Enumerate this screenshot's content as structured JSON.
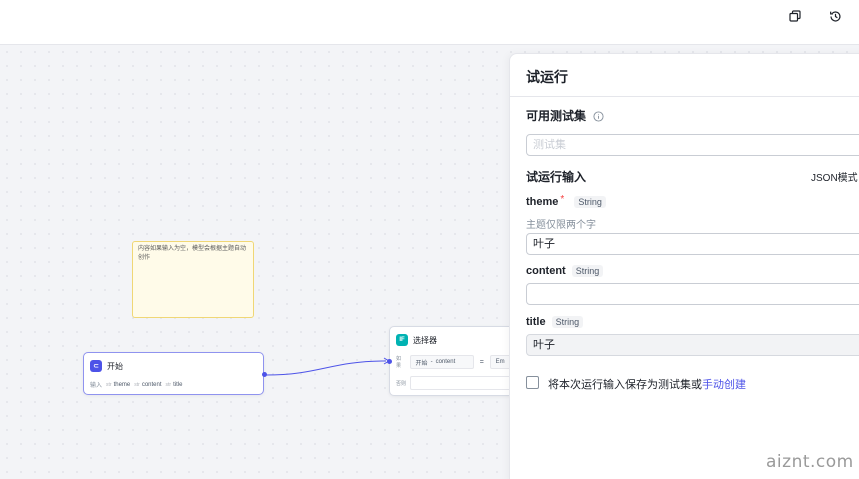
{
  "canvas": {
    "note": {
      "text": "内容如果输入为空，模型会根据主题自动创作"
    },
    "start_node": {
      "icon_text": "⊂",
      "title": "开始",
      "input_label": "输入",
      "params": [
        {
          "type": "str",
          "name": "theme"
        },
        {
          "type": "str",
          "name": "content"
        },
        {
          "type": "str",
          "name": "title"
        }
      ]
    },
    "if_node": {
      "icon_text": "IF",
      "title": "选择器",
      "if_label": "如果",
      "condition_source": "开始",
      "condition_sep": "-",
      "condition_field": "content",
      "condition_op": "=",
      "condition_value": "Em",
      "else_label": "否则"
    }
  },
  "panel": {
    "title": "试运行",
    "testset_section": "可用测试集",
    "testset_placeholder": "测试集",
    "input_section": "试运行输入",
    "json_mode": "JSON模式",
    "fields": [
      {
        "name": "theme",
        "required_mark": "*",
        "type": "String",
        "hint": "主题仅限两个字",
        "value": "叶子"
      },
      {
        "name": "content",
        "type": "String",
        "value": ""
      },
      {
        "name": "title",
        "type": "String",
        "value": "叶子"
      }
    ],
    "save_text": "将本次运行输入保存为测试集或",
    "save_link": "手动创建"
  },
  "watermark": "aiznt.com",
  "colors": {
    "accent": "#4d53e8",
    "start_icon": "#4d53e8",
    "if_icon": "#00b2b2",
    "note_bg": "#fffbe9",
    "note_border": "#f0d775"
  },
  "icons": {
    "top_left": "copy-icon",
    "top_right": "history-icon",
    "info": "info-icon"
  }
}
